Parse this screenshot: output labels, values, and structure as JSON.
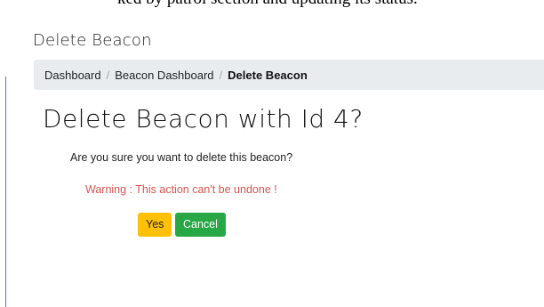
{
  "app": {
    "page_heading": "Delete Beacon",
    "top_strip_text": "ked by patrol section and updating its status."
  },
  "breadcrumb": {
    "items": [
      {
        "label": "Dashboard"
      },
      {
        "label": "Beacon Dashboard"
      },
      {
        "label": "Delete Beacon"
      }
    ],
    "separator": "/"
  },
  "main": {
    "title": "Delete Beacon with Id 4?",
    "question": "Are you sure you want to delete this beacon?",
    "warning": "Warning : This action can't be undone !"
  },
  "buttons": {
    "yes_label": "Yes",
    "cancel_label": "Cancel"
  },
  "colors": {
    "warning_text": "#d9534f",
    "yes_button": "#ffc107",
    "cancel_button": "#28a745",
    "breadcrumb_bg": "#e9ecef"
  }
}
